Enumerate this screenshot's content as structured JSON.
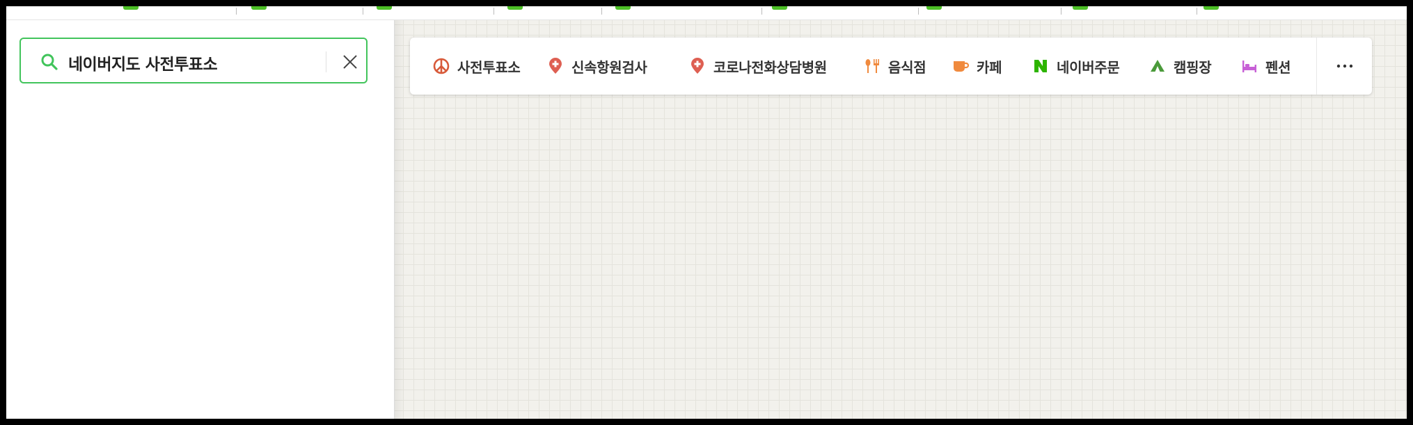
{
  "search": {
    "query": "네이버지도 사전투표소"
  },
  "categories": [
    {
      "label": "사전투표소",
      "icon": "peace-sign-icon",
      "color": "#d85a3a"
    },
    {
      "label": "신속항원검사",
      "icon": "medical-pin-icon",
      "color": "#de5f52"
    },
    {
      "label": "코로나전화상담병원",
      "icon": "medical-pin-icon",
      "color": "#de5f52"
    },
    {
      "label": "음식점",
      "icon": "restaurant-icon",
      "color": "#f08a3e"
    },
    {
      "label": "카페",
      "icon": "cafe-cup-icon",
      "color": "#f08a3e"
    },
    {
      "label": "네이버주문",
      "icon": "naver-n-icon",
      "color": "#2db400"
    },
    {
      "label": "캠핑장",
      "icon": "tent-icon",
      "color": "#4a9a3a"
    },
    {
      "label": "펜션",
      "icon": "bed-icon",
      "color": "#c760d6"
    }
  ],
  "more": {
    "icon": "more-dots-icon"
  },
  "colors": {
    "search_border": "#41c45b",
    "map_background": "#f2f1ec"
  }
}
